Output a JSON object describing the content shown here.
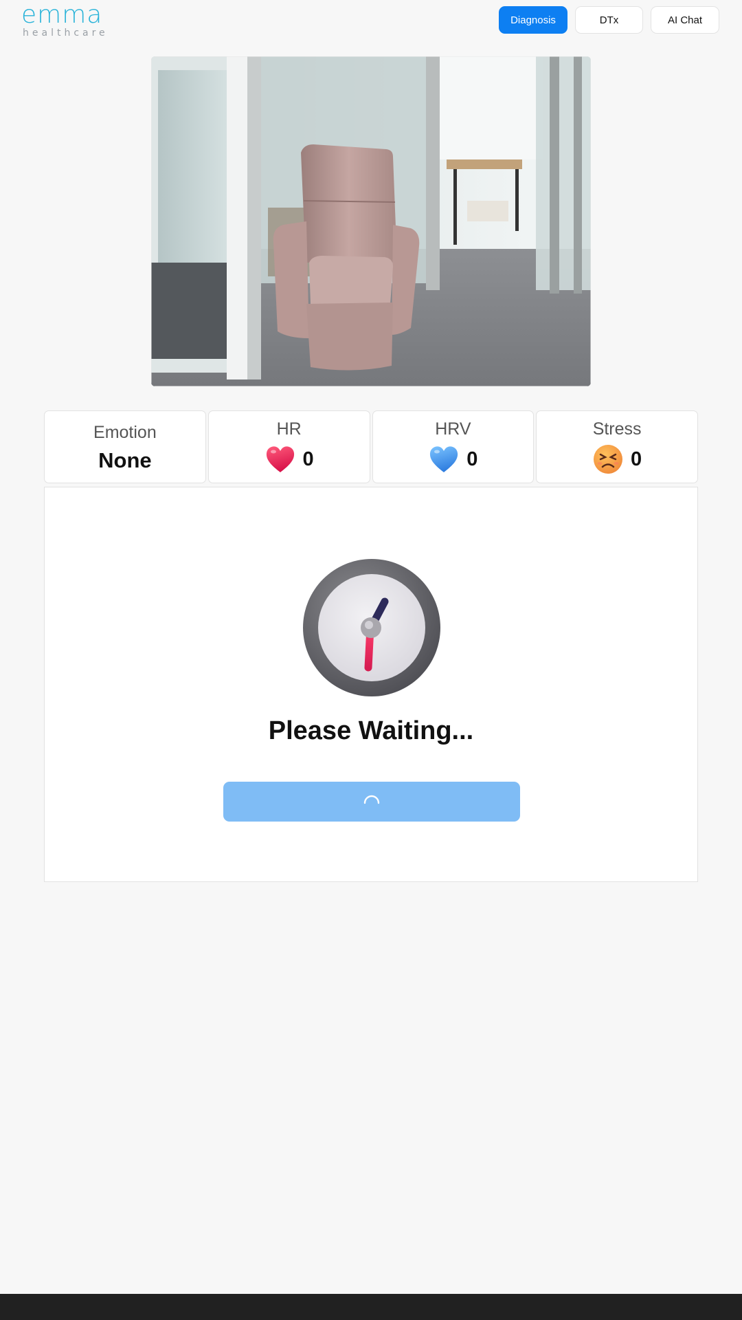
{
  "brand": {
    "name": "emma",
    "tagline": "healthcare",
    "color": "#29b3d9"
  },
  "nav": {
    "items": [
      {
        "label": "Diagnosis",
        "active": true
      },
      {
        "label": "DTx",
        "active": false
      },
      {
        "label": "AI Chat",
        "active": false
      }
    ],
    "active_color": "#0d7ff2"
  },
  "camera": {
    "content": "camera-feed-icon"
  },
  "metrics": {
    "emotion": {
      "label": "Emotion",
      "value": "None"
    },
    "hr": {
      "label": "HR",
      "value": "0",
      "icon": "red-heart-icon"
    },
    "hrv": {
      "label": "HRV",
      "value": "0",
      "icon": "blue-heart-icon"
    },
    "stress": {
      "label": "Stress",
      "value": "0",
      "icon": "stressed-face-icon"
    }
  },
  "status": {
    "icon": "clock-icon",
    "message": "Please Waiting...",
    "button_state": "loading",
    "button_color": "#7fbcf5"
  }
}
